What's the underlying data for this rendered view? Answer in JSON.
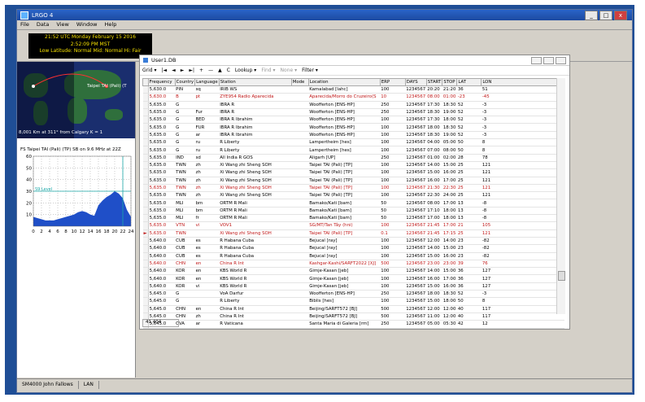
{
  "app": {
    "title": "LRGO 4",
    "window_buttons": [
      "_",
      "□",
      "x"
    ]
  },
  "menu": [
    "File",
    "Data",
    "View",
    "Window",
    "Help"
  ],
  "clock": {
    "line1": "21:52 UTC  Monday February 15 2016",
    "line2": "2:52:09 PM MST",
    "line3": "Low Latitude: Normal   Mid: Normal   Hi: Fair"
  },
  "map": {
    "station_label": "Taipei TAI (Pali) (T",
    "footer": "8,001 Km at 311° from Calgary   K = 1"
  },
  "prop": {
    "title": "FS Taipei TAI (Pali) (TP)  SB on 9.6 MHz at 22Z",
    "y_ticks": [
      "60",
      "50",
      "40",
      "30",
      "20",
      "10"
    ],
    "x_ticks": [
      "0",
      "2",
      "4",
      "6",
      "8",
      "10",
      "12",
      "14",
      "16",
      "18",
      "20",
      "22",
      "24"
    ],
    "level_label": "S9 Level",
    "chart_data": {
      "type": "area",
      "x": [
        0,
        1,
        2,
        3,
        4,
        5,
        6,
        7,
        8,
        9,
        10,
        11,
        12,
        13,
        14,
        15,
        16,
        17,
        18,
        19,
        20,
        21,
        22,
        23,
        24
      ],
      "values": [
        8,
        7,
        6,
        5,
        5,
        5,
        6,
        7,
        8,
        9,
        10,
        12,
        13,
        12,
        10,
        9,
        18,
        22,
        25,
        27,
        30,
        28,
        24,
        14,
        8
      ],
      "ylim": [
        0,
        60
      ],
      "xlim": [
        0,
        24
      ],
      "s9_level": 30,
      "marker_x": 22,
      "grid": true
    }
  },
  "statusbar": [
    "SM4000 John Fallows",
    "LAN"
  ],
  "child": {
    "title": "User1.DB",
    "toolbar": [
      "Grid ▾",
      "|◄",
      "◄",
      "►",
      "►|",
      "+",
      "—",
      "▲",
      "C",
      "Lookup ▾",
      "Find ▾",
      "None ▾",
      "Filter ▾"
    ],
    "footer": "41,404",
    "columns": [
      "",
      "Frequency",
      "Country",
      "Language",
      "Station",
      "Mode",
      "Location",
      "ERP",
      "DAYS",
      "START",
      "STOP",
      "LAT",
      "LON"
    ],
    "rows": [
      [
        "",
        "5,630.0",
        "PIN",
        "sq",
        "IRIB WS",
        "",
        "Kamalabad [Iahc]",
        "100",
        "1234567",
        "20:20",
        "21:20",
        "36",
        "51",
        ""
      ],
      [
        "",
        "5,630.0",
        "B",
        "pt",
        "ZYE954 Radio Aparecida",
        "",
        "Aparecida/Morro do Cruzeiro(S",
        "10",
        "1234567",
        "08:00",
        "01:00",
        "-23",
        "-45",
        "red"
      ],
      [
        "",
        "5,635.0",
        "G",
        "",
        "IBRA R",
        "",
        "Woofferton [ENS-HP]",
        "250",
        "1234567",
        "17:30",
        "18:30",
        "52",
        "-3",
        ""
      ],
      [
        "",
        "5,635.0",
        "G",
        "Fur",
        "IBRA R",
        "",
        "Woofferton [ENS-HP]",
        "250",
        "1234567",
        "18:30",
        "19:00",
        "52",
        "-3",
        ""
      ],
      [
        "",
        "5,635.0",
        "G",
        "BED",
        "IBRA R Ibrahim",
        "",
        "Woofferton [ENS-HP]",
        "100",
        "1234567",
        "17:30",
        "18:00",
        "52",
        "-3",
        ""
      ],
      [
        "",
        "5,635.0",
        "G",
        "FUR",
        "IBRA R Ibrahim",
        "",
        "Woofferton [ENS-HP]",
        "100",
        "1234567",
        "18:00",
        "18:30",
        "52",
        "-3",
        ""
      ],
      [
        "",
        "5,635.0",
        "G",
        "ar",
        "IBRA R Ibrahim",
        "",
        "Woofferton [ENS-HP]",
        "100",
        "1234567",
        "18:30",
        "19:00",
        "52",
        "-3",
        ""
      ],
      [
        "",
        "5,635.0",
        "G",
        "ru",
        "R Liberty",
        "",
        "Lampertheim [hes]",
        "100",
        "1234567",
        "04:00",
        "05:00",
        "50",
        "8",
        ""
      ],
      [
        "",
        "5,635.0",
        "G",
        "ru",
        "R Liberty",
        "",
        "Lampertheim [hes]",
        "100",
        "1234567",
        "07:00",
        "08:00",
        "50",
        "8",
        ""
      ],
      [
        "",
        "5,635.0",
        "IND",
        "sd",
        "All India R GOS",
        "",
        "Aligarh [UP]",
        "250",
        "1234567",
        "01:00",
        "02:00",
        "28",
        "78",
        ""
      ],
      [
        "",
        "5,635.0",
        "TWN",
        "zh",
        "Xi Wang zhi Sheng SOH",
        "",
        "Taipei TAI (Pali) [TP]",
        "100",
        "1234567",
        "14:00",
        "15:00",
        "25",
        "121",
        ""
      ],
      [
        "",
        "5,635.0",
        "TWN",
        "zh",
        "Xi Wang zhi Sheng SOH",
        "",
        "Taipei TAI (Pali) [TP]",
        "100",
        "1234567",
        "15:00",
        "16:00",
        "25",
        "121",
        ""
      ],
      [
        "",
        "5,635.0",
        "TWN",
        "zh",
        "Xi Wang zhi Sheng SOH",
        "",
        "Taipei TAI (Pali) [TP]",
        "100",
        "1234567",
        "16:00",
        "17:00",
        "25",
        "121",
        ""
      ],
      [
        "",
        "5,635.0",
        "TWN",
        "zh",
        "Xi Wang zhi Sheng SOH",
        "",
        "Taipei TAI (Pali) [TP]",
        "100",
        "1234567",
        "21:30",
        "22:30",
        "25",
        "121",
        "red"
      ],
      [
        "",
        "5,635.0",
        "TWN",
        "zh",
        "Xi Wang zhi Sheng SOH",
        "",
        "Taipei TAI (Pali) [TP]",
        "100",
        "1234567",
        "22:30",
        "24:00",
        "25",
        "121",
        ""
      ],
      [
        "",
        "5,635.0",
        "MLI",
        "bm",
        "ORTM R Mali",
        "",
        "Bamako/Kati [bam]",
        "50",
        "1234567",
        "08:00",
        "17:00",
        "13",
        "-8",
        ""
      ],
      [
        "",
        "5,635.0",
        "MLI",
        "bm",
        "ORTM R Mali",
        "",
        "Bamako/Kati [bam]",
        "50",
        "1234567",
        "17:10",
        "18:00",
        "13",
        "-8",
        ""
      ],
      [
        "",
        "5,635.0",
        "MLI",
        "fr",
        "ORTM R Mali",
        "",
        "Bamako/Kati [bam]",
        "50",
        "1234567",
        "17:00",
        "18:00",
        "13",
        "-8",
        ""
      ],
      [
        "",
        "5,635.0",
        "VTN",
        "vi",
        "VOV1",
        "",
        "SG/MT/Tan Tây (hni)",
        "100",
        "1234567",
        "21:45",
        "17:00",
        "21",
        "105",
        "red"
      ],
      [
        "►",
        "5,635.0",
        "TWN",
        "",
        "Xi Wang zhi Sheng SOH",
        "",
        "Taipei TAI (Pali) [TP]",
        "0.1",
        "1234567",
        "21:45",
        "17:15",
        "25",
        "121",
        "red"
      ],
      [
        "",
        "5,640.0",
        "CUB",
        "es",
        "R Habana Cuba",
        "",
        "Bejucal [ray]",
        "100",
        "1234567",
        "12:00",
        "14:00",
        "23",
        "-82",
        ""
      ],
      [
        "",
        "5,640.0",
        "CUB",
        "es",
        "R Habana Cuba",
        "",
        "Bejucal [ray]",
        "100",
        "1234567",
        "14:00",
        "15:00",
        "23",
        "-82",
        ""
      ],
      [
        "",
        "5,640.0",
        "CUB",
        "es",
        "R Habana Cuba",
        "",
        "Bejucal [ray]",
        "100",
        "1234567",
        "15:00",
        "16:00",
        "23",
        "-82",
        ""
      ],
      [
        "",
        "5,640.0",
        "CHN",
        "en",
        "China R Int",
        "",
        "Kashgar-Kashi/SARFT2022 [XJ]",
        "500",
        "1234567",
        "23:00",
        "23:00",
        "39",
        "76",
        "red"
      ],
      [
        "",
        "5,640.0",
        "KOR",
        "en",
        "KBS World R",
        "",
        "Gimje-Kasan [jeb]",
        "100",
        "1234567",
        "14:00",
        "15:00",
        "36",
        "127",
        ""
      ],
      [
        "",
        "5,640.0",
        "KOR",
        "en",
        "KBS World R",
        "",
        "Gimje-Kasan [jeb]",
        "100",
        "1234567",
        "16:00",
        "17:00",
        "36",
        "127",
        ""
      ],
      [
        "",
        "5,640.0",
        "KOR",
        "vi",
        "KBS World R",
        "",
        "Gimje-Kasan [jeb]",
        "100",
        "1234567",
        "15:00",
        "16:00",
        "36",
        "127",
        ""
      ],
      [
        "",
        "5,645.0",
        "G",
        "",
        "VoA Darfur",
        "",
        "Woofferton [ENS-HP]",
        "250",
        "1234567",
        "18:00",
        "18:30",
        "52",
        "-3",
        ""
      ],
      [
        "",
        "5,645.0",
        "G",
        "",
        "R Liberty",
        "",
        "Biblis [hes]",
        "100",
        "1234567",
        "15:00",
        "18:00",
        "50",
        "8",
        ""
      ],
      [
        "",
        "5,645.0",
        "CHN",
        "en",
        "China R Int",
        "",
        "Beijing/SARFT572 [BJ]",
        "500",
        "1234567",
        "12:00",
        "12:00",
        "40",
        "117",
        ""
      ],
      [
        "",
        "5,645.0",
        "CHN",
        "zh",
        "China R Int",
        "",
        "Beijing/SARFT572 [BJ]",
        "500",
        "1234567",
        "11:00",
        "12:00",
        "40",
        "117",
        ""
      ],
      [
        "",
        "5,645.0",
        "CVA",
        "ar",
        "R Vaticana",
        "",
        "Santa Maria di Galeria [rm]",
        "250",
        "1234567",
        "05:00",
        "05:30",
        "42",
        "12",
        ""
      ]
    ]
  }
}
